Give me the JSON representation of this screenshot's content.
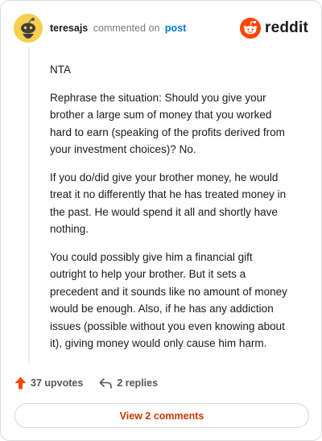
{
  "header": {
    "username": "teresajs",
    "action": "commented on",
    "target": "post",
    "brand": "reddit",
    "avatar_icon": "snoo-avatar-icon",
    "logo_icon": "reddit-logo-icon"
  },
  "comment": {
    "paragraphs": [
      "NTA",
      "Rephrase the situation: Should you give your brother a large sum of money that you worked hard to earn (speaking of the profits derived from your investment choices)? No.",
      "If you do/did give your brother money, he would treat it no differently that he has treated money in the past. He would spend it all and shortly have nothing.",
      "You could possibly give him a financial gift outright to help your brother. But it sets a precedent and it sounds like no amount of money would be enough. Also, if he has any addiction issues (possible without you even knowing about it), giving money would only cause him harm."
    ]
  },
  "footer": {
    "upvotes": "37 upvotes",
    "replies": "2 replies",
    "upvote_icon": "upvote-arrow-icon",
    "reply_icon": "reply-icon"
  },
  "view_button": {
    "label": "View 2 comments"
  },
  "colors": {
    "brand": "#ff4500",
    "link": "#0079d3",
    "button_text": "#cc3700",
    "avatar": "#f6d04d"
  }
}
